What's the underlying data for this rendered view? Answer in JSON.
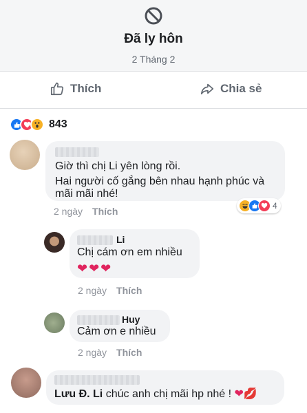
{
  "post": {
    "title": "Đã ly hôn",
    "date": "2 Tháng 2"
  },
  "actions": {
    "like_label": "Thích",
    "share_label": "Chia sẻ"
  },
  "reactions": {
    "count": "843",
    "icons": [
      "like-icon",
      "love-icon",
      "wow-icon"
    ]
  },
  "comments": [
    {
      "name": "",
      "text_line1": "Giờ thì chị Li yên lòng rồi.",
      "text_line2": "Hai người cố gắng bên nhau hạnh phúc và",
      "text_line3": "mãi mãi nhé!",
      "time": "2 ngày",
      "like_label": "Thích",
      "reaction_count": "4",
      "reaction_icons": [
        "haha-icon",
        "like-icon",
        "love-icon"
      ]
    },
    {
      "name": "Li",
      "text": "Chị cám ơn em nhiều",
      "emoji": "❤❤❤",
      "time": "2 ngày",
      "like_label": "Thích"
    },
    {
      "name": "Huy",
      "text": "Cảm ơn e nhiều",
      "time": "2 ngày",
      "like_label": "Thích"
    },
    {
      "name": "",
      "text_bold": "Lưu Đ. Li",
      "text": " chúc anh chị mãi hp nhé ! ",
      "emoji": "❤💋"
    }
  ],
  "colors": {
    "like_blue": "#1877f2",
    "love_red": "#f33e58",
    "wow_yellow": "#f7b125",
    "heart": "#e0245e"
  }
}
